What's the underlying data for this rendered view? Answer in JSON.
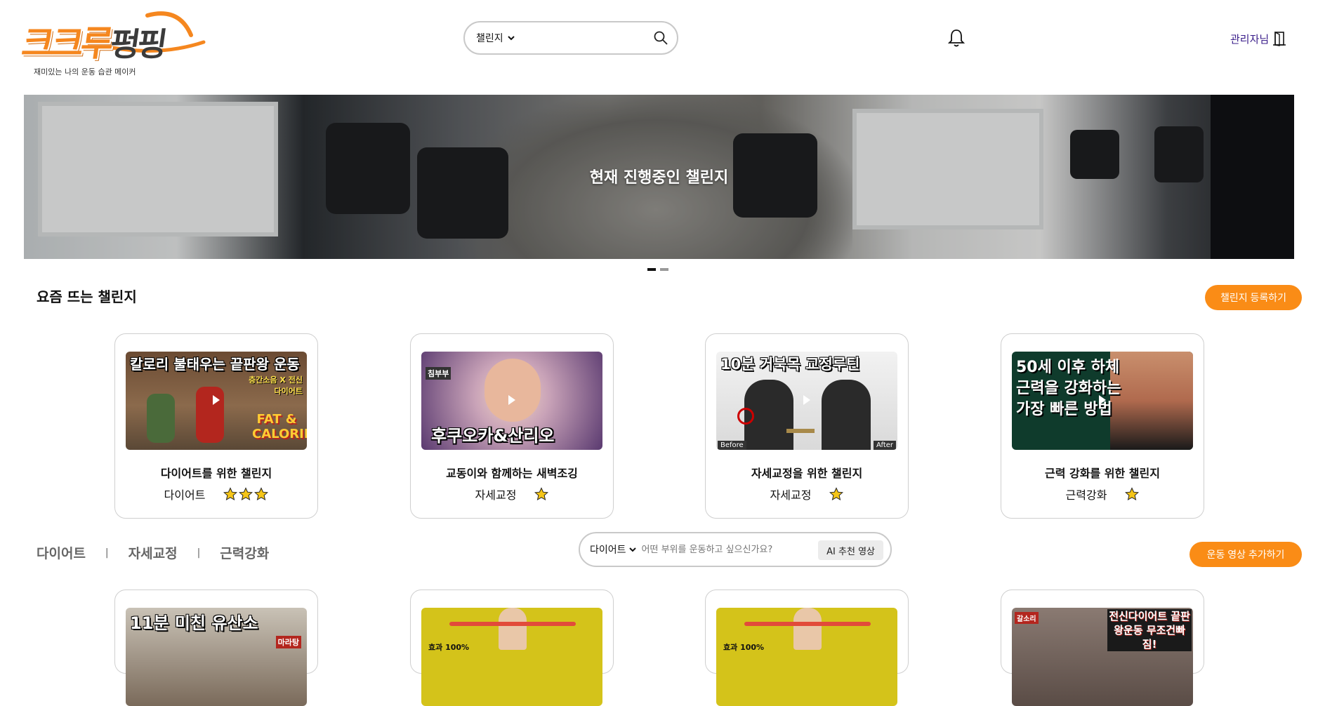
{
  "header": {
    "logo_main_orange": "크크루",
    "logo_main_dark": "펑핑",
    "logo_tagline": "재미있는 나의 운동 습관 메이커",
    "search": {
      "select_value": "챌린지",
      "placeholder": ""
    },
    "admin_label": "관리자님"
  },
  "banner": {
    "title": "현재 진행중인 챌린지",
    "dots": 2,
    "active_dot": 0
  },
  "popular": {
    "title": "요즘 뜨는 챌린지",
    "register_button": "챌린지 등록하기",
    "cards": [
      {
        "title": "다이어트를 위한 챌린지",
        "category": "다이어트",
        "stars": 3,
        "thumb_text": "칼로리 불태우는 끝판왕 운동",
        "thumb_sub": "FAT & CALORIE",
        "thumb_side": "층간소음 X 전신다이어트"
      },
      {
        "title": "교동이와 함께하는 새벽조깅",
        "category": "자세교정",
        "stars": 1,
        "thumb_text": "후쿠오카&산리오",
        "thumb_side": "침부부"
      },
      {
        "title": "자세교정을 위한 챌린지",
        "category": "자세교정",
        "stars": 1,
        "thumb_text": "10분 거북목 교정루틴",
        "thumb_before": "Before",
        "thumb_after": "After"
      },
      {
        "title": "근력 강화를 위한 챌린지",
        "category": "근력강화",
        "stars": 1,
        "thumb_text": "50세 이후 하체 근력을 강화하는 가장 빠른 방법"
      }
    ]
  },
  "videos": {
    "tabs": [
      "다이어트",
      "자세교정",
      "근력강화"
    ],
    "search": {
      "select_value": "다이어트",
      "placeholder": "어떤 부위를 운동하고 싶으신가요?",
      "ai_button": "AI 추천 영상"
    },
    "add_button": "운동 영상 추가하기",
    "cards": [
      {
        "thumb_text": "11분 미친 유산소",
        "thumb_side": "마라탕"
      },
      {
        "thumb_text": "효과 100%"
      },
      {
        "thumb_text": "효과 100%"
      },
      {
        "thumb_text": "전신다이어트 끝판왕운동 무조건빠짐!",
        "thumb_side": "갈소리"
      }
    ]
  },
  "colors": {
    "accent": "#fa8c16",
    "admin": "#3a1d8a",
    "star": "#f5c518"
  }
}
